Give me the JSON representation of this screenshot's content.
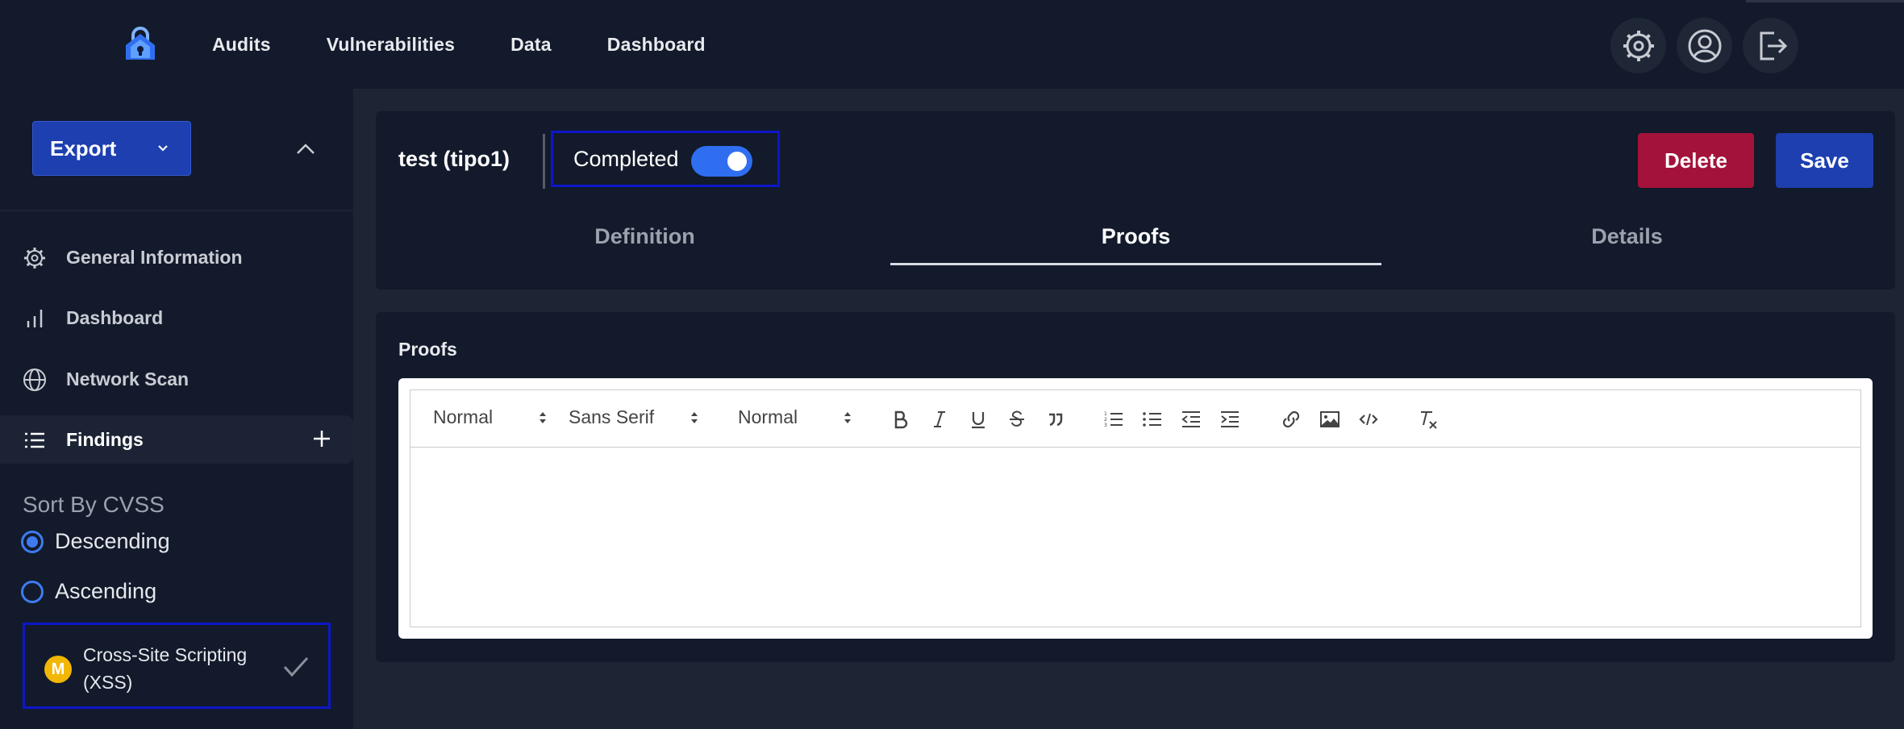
{
  "nav": {
    "links": [
      "Audits",
      "Vulnerabilities",
      "Data",
      "Dashboard"
    ]
  },
  "sidebar": {
    "export_label": "Export",
    "items": [
      {
        "label": "General Information",
        "icon": "gear-icon"
      },
      {
        "label": "Dashboard",
        "icon": "bar-chart-icon"
      },
      {
        "label": "Network Scan",
        "icon": "globe-icon"
      },
      {
        "label": "Findings",
        "icon": "list-icon"
      }
    ],
    "sort_title": "Sort By CVSS",
    "sort_options": [
      {
        "label": "Descending",
        "selected": true
      },
      {
        "label": "Ascending",
        "selected": false
      }
    ],
    "finding": {
      "severity": "M",
      "title": "Cross-Site Scripting (XSS)",
      "severity_color": "#f2b705"
    }
  },
  "header": {
    "title": "test (tipo1)",
    "completed_label": "Completed",
    "completed": true,
    "delete_label": "Delete",
    "save_label": "Save",
    "tabs": [
      {
        "label": "Definition",
        "active": false
      },
      {
        "label": "Proofs",
        "active": true
      },
      {
        "label": "Details",
        "active": false
      }
    ]
  },
  "proofs": {
    "label": "Proofs",
    "toolbar": {
      "heading": "Normal",
      "font": "Sans Serif",
      "size": "Normal"
    },
    "content": ""
  },
  "colors": {
    "accent": "#1d3faf",
    "danger": "#a3123a",
    "toggle": "#2f6ef0"
  }
}
